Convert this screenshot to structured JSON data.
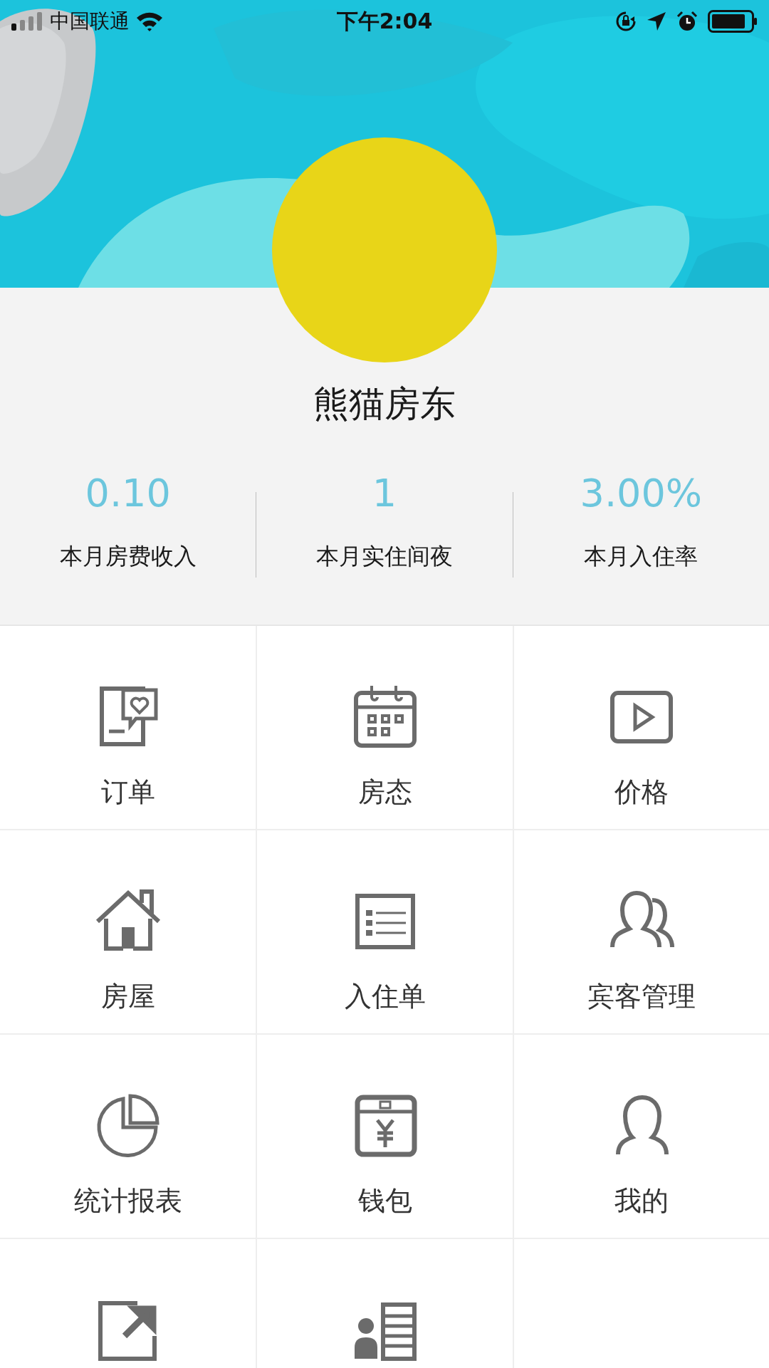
{
  "status_bar": {
    "carrier": "中国联通",
    "time": "下午2:04"
  },
  "header": {
    "avatar": {
      "kind": "avatar"
    }
  },
  "profile": {
    "name": "熊猫房东"
  },
  "stats": [
    {
      "value": "0.10",
      "label": "本月房费收入"
    },
    {
      "value": "1",
      "label": "本月实住间夜"
    },
    {
      "value": "3.00%",
      "label": "本月入住率"
    }
  ],
  "menu": [
    {
      "kind": "tile",
      "label": "订单"
    },
    {
      "kind": "tile",
      "label": "房态"
    },
    {
      "kind": "tile",
      "label": "价格"
    },
    {
      "kind": "tile",
      "label": "房屋"
    },
    {
      "kind": "tile",
      "label": "入住单"
    },
    {
      "kind": "tile",
      "label": "宾客管理"
    },
    {
      "kind": "tile",
      "label": "统计报表"
    },
    {
      "kind": "tile",
      "label": "钱包"
    },
    {
      "kind": "tile",
      "label": "我的"
    },
    {
      "kind": "icon-only"
    },
    {
      "kind": "icon-only"
    },
    {
      "kind": "empty"
    }
  ]
}
